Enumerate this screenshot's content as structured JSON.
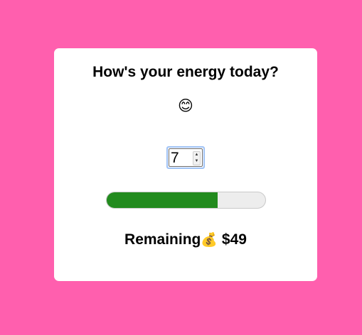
{
  "card": {
    "title": "How's your energy today?",
    "emoji": "😊",
    "emoji_icon": "smiling-face-icon"
  },
  "energy": {
    "value": "7",
    "max": 10,
    "progress_fraction": 0.7,
    "progress_color": "#228b1e"
  },
  "remaining": {
    "label": "Remaining",
    "icon": "💰",
    "icon_name": "money-bag-icon",
    "amount": "$49"
  },
  "colors": {
    "background": "#ff5fae",
    "card": "#ffffff",
    "focus_ring": "#9fc2f5"
  }
}
